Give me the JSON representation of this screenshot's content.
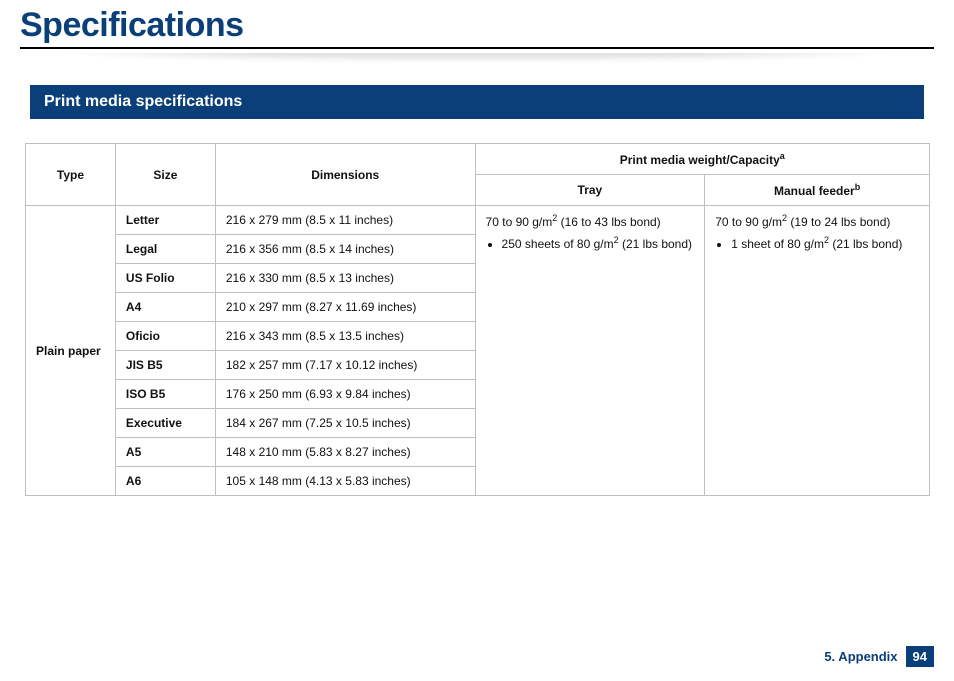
{
  "title": "Specifications",
  "section_heading": "Print media specifications",
  "table": {
    "headers": {
      "type": "Type",
      "size": "Size",
      "dimensions": "Dimensions",
      "capacity_group": "Print media weight/Capacity",
      "capacity_sup": "a",
      "tray": "Tray",
      "manual_feeder": "Manual feeder",
      "manual_feeder_sup": "b"
    },
    "group_label": "Plain paper",
    "rows": [
      {
        "size": "Letter",
        "dim": "216 x 279 mm (8.5 x 11 inches)"
      },
      {
        "size": "Legal",
        "dim": "216 x 356 mm (8.5 x 14 inches)"
      },
      {
        "size": "US Folio",
        "dim": "216 x 330 mm (8.5 x 13 inches)"
      },
      {
        "size": "A4",
        "dim": "210 x 297 mm (8.27 x 11.69 inches)"
      },
      {
        "size": "Oficio",
        "dim": "216 x 343 mm (8.5 x 13.5 inches)"
      },
      {
        "size": "JIS B5",
        "dim": "182 x 257 mm (7.17 x 10.12 inches)"
      },
      {
        "size": "ISO B5",
        "dim": "176 x 250 mm (6.93 x 9.84 inches)"
      },
      {
        "size": "Executive",
        "dim": "184 x 267 mm (7.25 x 10.5 inches)"
      },
      {
        "size": "A5",
        "dim": "148 x 210 mm (5.83 x 8.27 inches)"
      },
      {
        "size": "A6",
        "dim": "105 x 148 mm (4.13 x 5.83 inches)"
      }
    ],
    "tray_cell": {
      "line1_pre": "70 to 90 g/m",
      "line1_sup": "2",
      "line1_post": " (16 to 43 lbs bond)",
      "bullet_pre": "250 sheets of 80 g/m",
      "bullet_sup": "2",
      "bullet_post": " (21 lbs bond)"
    },
    "feeder_cell": {
      "line1_pre": "70 to 90 g/m",
      "line1_sup": "2",
      "line1_post": " (19 to 24 lbs bond)",
      "bullet_pre": "1 sheet of 80 g/m",
      "bullet_sup": "2",
      "bullet_post": " (21 lbs bond)"
    }
  },
  "footer": {
    "chapter": "5. Appendix",
    "page": "94"
  }
}
